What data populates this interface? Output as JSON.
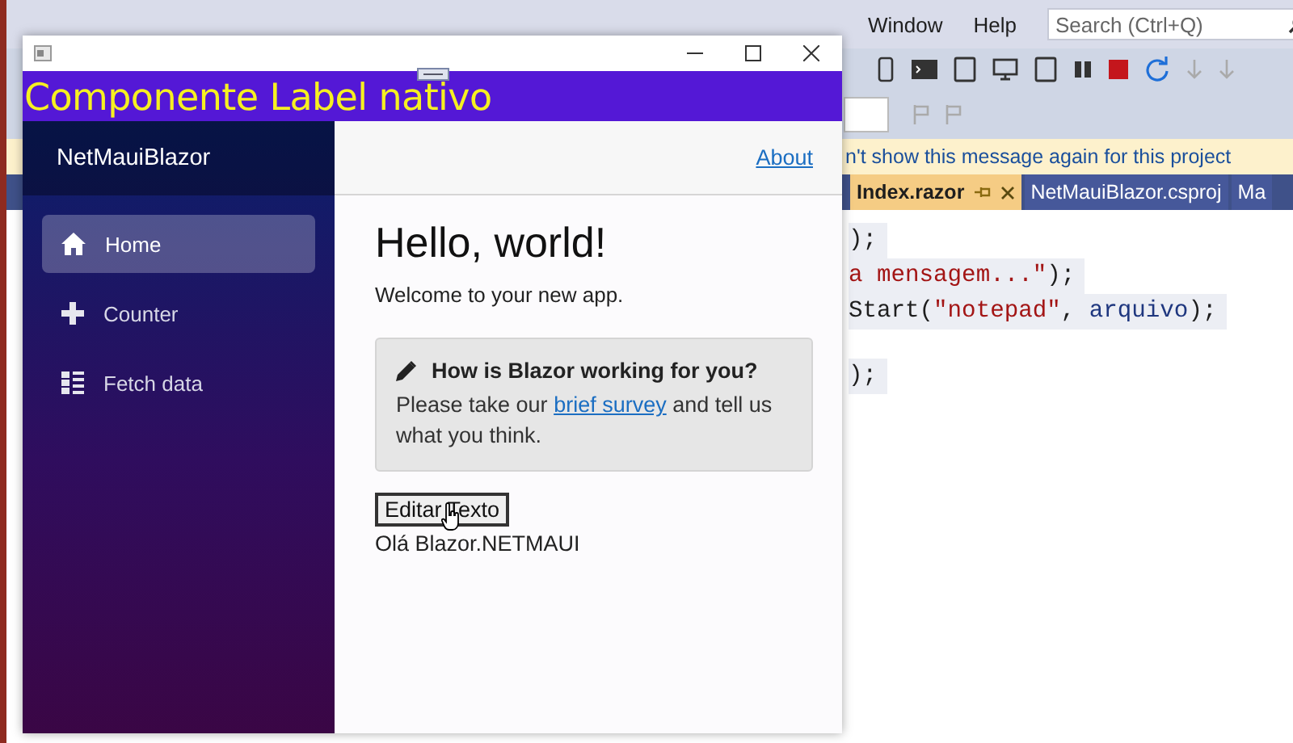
{
  "background_window": {
    "menu": [
      {
        "label": "Window"
      },
      {
        "label": "Help"
      }
    ],
    "search": {
      "placeholder": "Search (Ctrl+Q)"
    },
    "info_bar": "n't show this message again for this project",
    "tabs": [
      {
        "label": "Index.razor",
        "selected": true,
        "pinned": true
      },
      {
        "label": "NetMauiBlazor.csproj",
        "selected": false,
        "pinned": false
      },
      {
        "label": "Ma",
        "selected": false,
        "pinned": false
      }
    ],
    "code_lines": [
      {
        "tokens": [
          {
            "kind": "plain",
            "text": ");"
          }
        ]
      },
      {
        "tokens": [
          {
            "kind": "string",
            "text": "a mensagem...\""
          },
          {
            "kind": "plain",
            "text": ");"
          }
        ]
      },
      {
        "tokens": [
          {
            "kind": "plain",
            "text": "Start("
          },
          {
            "kind": "string",
            "text": "\"notepad\""
          },
          {
            "kind": "plain",
            "text": ", "
          },
          {
            "kind": "identifier",
            "text": "arquivo"
          },
          {
            "kind": "plain",
            "text": ");"
          }
        ]
      },
      {
        "blank_before": true,
        "tokens": [
          {
            "kind": "plain",
            "text": ");"
          }
        ]
      }
    ]
  },
  "app_window": {
    "banner": "Componente Label nativo",
    "sidebar": {
      "brand": "NetMauiBlazor",
      "items": [
        {
          "label": "Home",
          "kind": "home",
          "selected": true
        },
        {
          "label": "Counter",
          "kind": "plus",
          "selected": false
        },
        {
          "label": "Fetch data",
          "kind": "list",
          "selected": false
        }
      ]
    },
    "top_link": "About",
    "heading": "Hello, world!",
    "welcome": "Welcome to your new app.",
    "survey": {
      "title": "How is Blazor working for you?",
      "before": "Please take our ",
      "link": "brief survey",
      "after": " and tell us what you think."
    },
    "button": "Editar Texto",
    "label": "Olá Blazor.NETMAUI"
  }
}
